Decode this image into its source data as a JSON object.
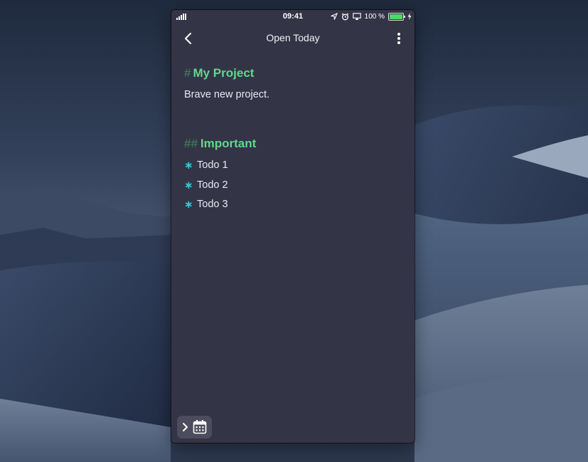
{
  "status_bar": {
    "time": "09:41",
    "battery_percent": "100 %",
    "battery_level": 1.0,
    "icons": [
      "signal-bars-icon",
      "location-arrow-icon",
      "alarm-clock-icon",
      "airplay-icon",
      "battery-icon",
      "charging-bolt-icon"
    ]
  },
  "nav": {
    "title": "Open Today",
    "back_icon": "chevron-left-icon",
    "more_icon": "vertical-ellipsis-icon"
  },
  "document": {
    "h1_marker": "#",
    "h1_text": "My Project",
    "paragraph": "Brave new project.",
    "h2_marker": "##",
    "h2_text": "Important",
    "bullet_glyph": "∗",
    "todos": [
      "Todo 1",
      "Todo 2",
      "Todo 3"
    ]
  },
  "bottom_toolbar": {
    "icons": [
      "chevron-right-icon",
      "calendar-icon"
    ]
  },
  "colors": {
    "app_background": "#343447",
    "heading_green": "#5fd88a",
    "heading_marker": "#3d8a5d",
    "bullet_cyan": "#39c5d6",
    "body_text": "#e8e8ee",
    "button_background": "#4c4c5e"
  }
}
